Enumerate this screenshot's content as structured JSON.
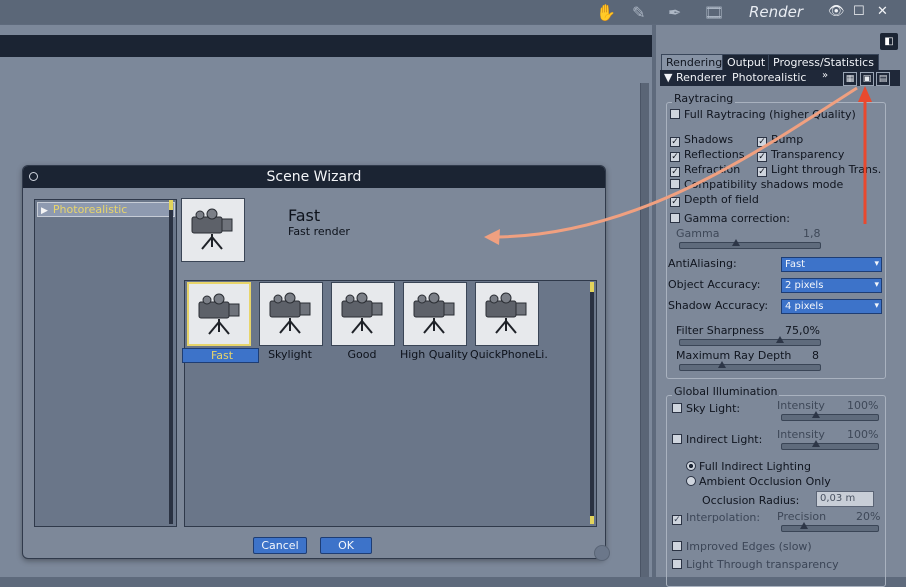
{
  "window": {
    "title": "Render",
    "toolbar_icons": [
      "hand-icon",
      "brush-icon",
      "pen-icon",
      "film-icon"
    ],
    "controls": [
      "eye-icon",
      "maximize-icon",
      "close-icon"
    ],
    "close_glyph": "✕",
    "max_glyph": "☐",
    "eye_glyph": "👁"
  },
  "panel": {
    "tabs": [
      "Rendering",
      "Output",
      "Progress/Statistics"
    ],
    "active_tab": "Rendering",
    "renderer_label": "Renderer",
    "renderer_value": "Photorealistic",
    "raytracing": {
      "title": "Raytracing",
      "full_raytracing": {
        "label": "Full Raytracing (higher Quality)",
        "checked": false
      },
      "shadows": {
        "label": "Shadows",
        "checked": true
      },
      "bump": {
        "label": "Bump",
        "checked": true
      },
      "reflections": {
        "label": "Reflections",
        "checked": true
      },
      "transparency": {
        "label": "Transparency",
        "checked": true
      },
      "refraction": {
        "label": "Refraction",
        "checked": true
      },
      "light_through": {
        "label": "Light through Trans.",
        "checked": true
      },
      "compat_shadows": {
        "label": "Compatibility shadows mode",
        "checked": false
      },
      "depth_of_field": {
        "label": "Depth of field",
        "checked": true
      },
      "gamma_correction": {
        "label": "Gamma correction:",
        "checked": false
      },
      "gamma_label": "Gamma",
      "gamma_value": "1,8",
      "antialiasing_label": "AntiAliasing:",
      "antialiasing_value": "Fast",
      "object_accuracy_label": "Object Accuracy:",
      "object_accuracy_value": "2 pixels",
      "shadow_accuracy_label": "Shadow Accuracy:",
      "shadow_accuracy_value": "4 pixels",
      "filter_sharpness_label": "Filter Sharpness",
      "filter_sharpness_value": "75,0%",
      "max_ray_depth_label": "Maximum Ray Depth",
      "max_ray_depth_value": "8"
    },
    "gi": {
      "title": "Global Illumination",
      "sky_light": {
        "label": "Sky Light:",
        "checked": false
      },
      "sky_intensity_label": "Intensity",
      "sky_intensity_value": "100%",
      "indirect_light": {
        "label": "Indirect Light:",
        "checked": false
      },
      "indirect_intensity_label": "Intensity",
      "indirect_intensity_value": "100%",
      "full_indirect": "Full Indirect Lighting",
      "ambient_occlusion": "Ambient Occlusion Only",
      "occlusion_radius_label": "Occlusion Radius:",
      "occlusion_radius_value": "0,03 m",
      "interpolation": {
        "label": "Interpolation:",
        "checked": true
      },
      "precision_label": "Precision",
      "precision_value": "20%",
      "improved_edges": {
        "label": "Improved Edges (slow)",
        "checked": false
      },
      "light_through_transparency": {
        "label": "Light Through transparency",
        "checked": false
      }
    }
  },
  "dialog": {
    "title": "Scene Wizard",
    "list": [
      "Photorealistic"
    ],
    "preview_title": "Fast",
    "preview_subtitle": "Fast render",
    "presets": [
      "Fast",
      "Skylight",
      "Good",
      "High Quality",
      "QuickPhoneLi."
    ],
    "selected_preset": "Fast",
    "cancel_label": "Cancel",
    "ok_label": "OK"
  },
  "annotation_color": "#e9492e",
  "arrow_color": "#f0a080"
}
